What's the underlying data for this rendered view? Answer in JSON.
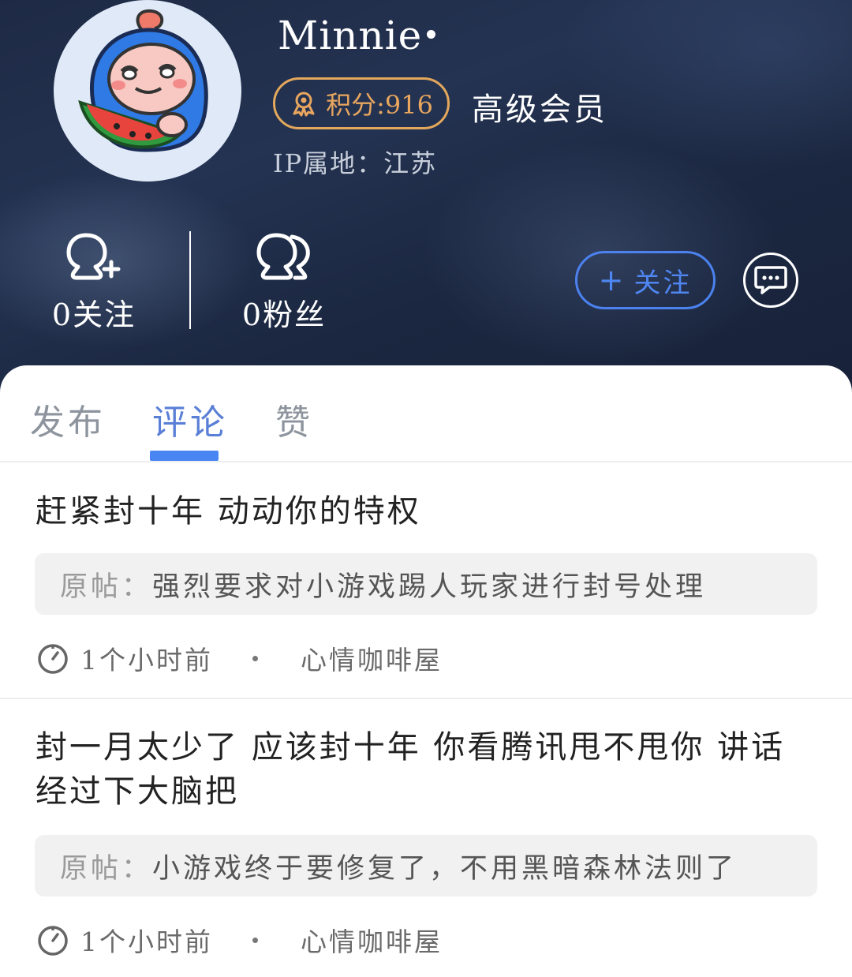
{
  "profile": {
    "username": "Minnie",
    "points_label": "积分:916",
    "vip_label": "高级会员",
    "ip_label": "IP属地：江苏",
    "follow_count": "0关注",
    "fans_count": "0粉丝",
    "follow_button": "关注",
    "avatar_icon": "watermelon-mascot-avatar",
    "message_icon": "chat-bubble-icon"
  },
  "colors": {
    "accent_blue": "#4a86f3",
    "badge_gold": "#e3a85c",
    "header_dark": "#1e2a45"
  },
  "tabs": [
    {
      "label": "发布",
      "active": false
    },
    {
      "label": "评论",
      "active": true
    },
    {
      "label": "赞",
      "active": false
    }
  ],
  "comments": [
    {
      "text": "赶紧封十年  动动你的特权",
      "orig_prefix": "原帖：",
      "orig_title": "强烈要求对小游戏踢人玩家进行封号处理",
      "time": "1个小时前",
      "board": "心情咖啡屋"
    },
    {
      "text": "封一月太少了  应该封十年  你看腾讯甩不甩你  讲话经过下大脑把",
      "orig_prefix": "原帖：",
      "orig_title": "小游戏终于要修复了，不用黑暗森林法则了",
      "time": "1个小时前",
      "board": "心情咖啡屋"
    }
  ]
}
